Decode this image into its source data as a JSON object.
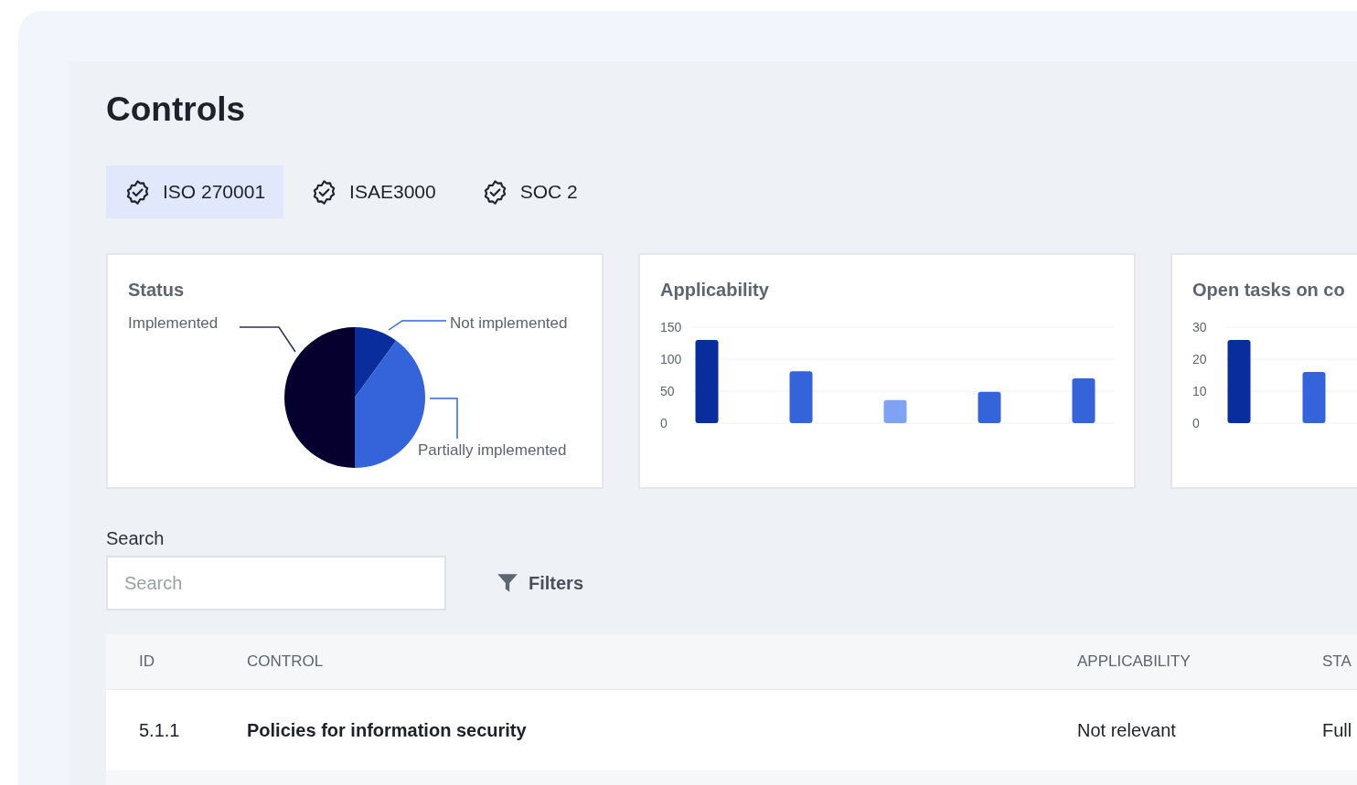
{
  "title": "Controls",
  "tabs": [
    {
      "label": "ISO 270001",
      "selected": true
    },
    {
      "label": "ISAE3000",
      "selected": false
    },
    {
      "label": "SOC 2",
      "selected": false
    }
  ],
  "status_card": {
    "title": "Status",
    "labels": [
      {
        "kind": "implemented",
        "text": "Implemented"
      },
      {
        "kind": "not_implemented",
        "text": "Not implemented"
      },
      {
        "kind": "partial",
        "text": "Partially implemented"
      }
    ]
  },
  "applicability_card": {
    "title": "Applicability",
    "chart_data": {
      "type": "bar",
      "yticks": [
        0,
        50,
        100,
        150
      ],
      "ylim": [
        0,
        150
      ],
      "values": [
        130,
        81,
        36,
        49,
        70
      ]
    }
  },
  "open_tasks_card": {
    "title": "Open tasks on co",
    "chart_data": {
      "type": "bar",
      "yticks": [
        0,
        10,
        20,
        30
      ],
      "ylim": [
        0,
        30
      ],
      "values": [
        26,
        16
      ]
    }
  },
  "search": {
    "label": "Search",
    "placeholder": "Search"
  },
  "filters_button": "Filters",
  "table": {
    "columns": [
      "ID",
      "CONTROL",
      "APPLICABILITY",
      "STA"
    ],
    "rows": [
      [
        "5.1.1",
        "Policies for information security",
        "Not relevant",
        "Full"
      ]
    ]
  }
}
